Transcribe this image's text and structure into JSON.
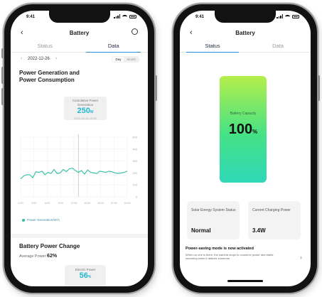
{
  "left": {
    "status_time": "9:41",
    "nav_title": "Battery",
    "tabs": [
      "Status",
      "Data"
    ],
    "active_tab": "Data",
    "date": "2022-12-26",
    "seg_options": [
      "Day",
      "Month"
    ],
    "section_title": "Power Generation and Power Consumption",
    "tooltip": {
      "label": "Cumulative Power Generation",
      "value": "250",
      "unit": "W",
      "time": "2022-12-26 13:00"
    },
    "chart_data": {
      "type": "line",
      "x": [
        "0:00",
        "3:00",
        "6:00",
        "9:00",
        "12:00",
        "15:00",
        "18:00",
        "21:00",
        "24:00"
      ],
      "y_ticks": [
        "500",
        "400",
        "300",
        "200",
        "100",
        "0"
      ],
      "series": [
        {
          "name": "Power Generation/W-h",
          "values": [
            150,
            175,
            185,
            185,
            160,
            210,
            205,
            215,
            185,
            205,
            195,
            230,
            195,
            200,
            230,
            210,
            235,
            240,
            220,
            205,
            220,
            190,
            225,
            205,
            200,
            195,
            215,
            210,
            205,
            215,
            210,
            200,
            195,
            200,
            205,
            215
          ]
        }
      ],
      "ylim": [
        0,
        500
      ],
      "color": "#2fbfa3"
    },
    "legend": "Power Generation/W-h",
    "section2_title": "Battery Power Change",
    "avg_label": "Average Power",
    "avg_value": "62%",
    "elec_label": "Electric Power",
    "elec_value": "56",
    "elec_unit": "%"
  },
  "right": {
    "status_time": "9:41",
    "nav_title": "Battery",
    "tabs": [
      "Status",
      "Data"
    ],
    "active_tab": "Status",
    "battery_label": "Battery Capacity",
    "battery_value": "100",
    "battery_unit": "%",
    "battery_level": 100,
    "card1_label": "Solar Energy System Status",
    "card1_value": "Normal",
    "card2_label": "Current Charging Power",
    "card2_value": "3.4W",
    "notice_title": "Power-saving mode is now activated",
    "notice_desc": "When no one is there, the camera stops to conserve power and starts recording when it detects someone."
  },
  "colors": {
    "accent": "#2a8fe0",
    "teal": "#1fb8cf",
    "green": "#45e286"
  }
}
